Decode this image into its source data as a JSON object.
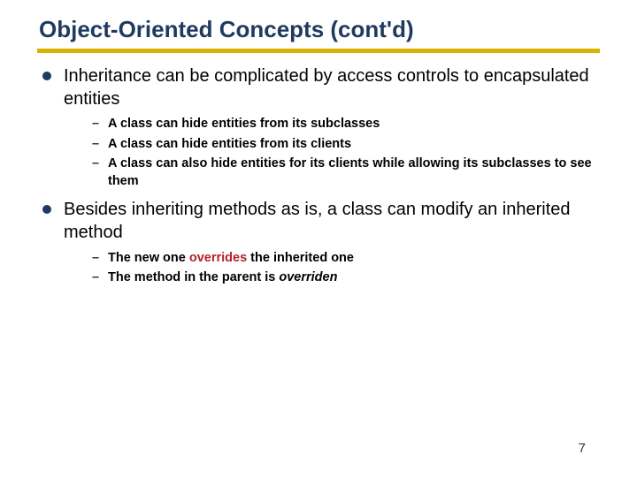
{
  "title": "Object-Oriented Concepts (cont'd)",
  "bullets": {
    "b1": "Inheritance can be complicated by access controls to encapsulated entities",
    "b1s": {
      "a": "A class can hide entities from its subclasses",
      "b": "A class can hide entities from its clients",
      "c": "A class can also hide entities for its clients while allowing its subclasses to see them"
    },
    "b2": "Besides inheriting methods as is, a class can modify an inherited method",
    "b2s": {
      "a_pre": "The new one ",
      "a_hl": "overrides",
      "a_post": " the inherited one",
      "b_pre": "The method in the parent is ",
      "b_it": "overriden"
    }
  },
  "page_number": "7"
}
